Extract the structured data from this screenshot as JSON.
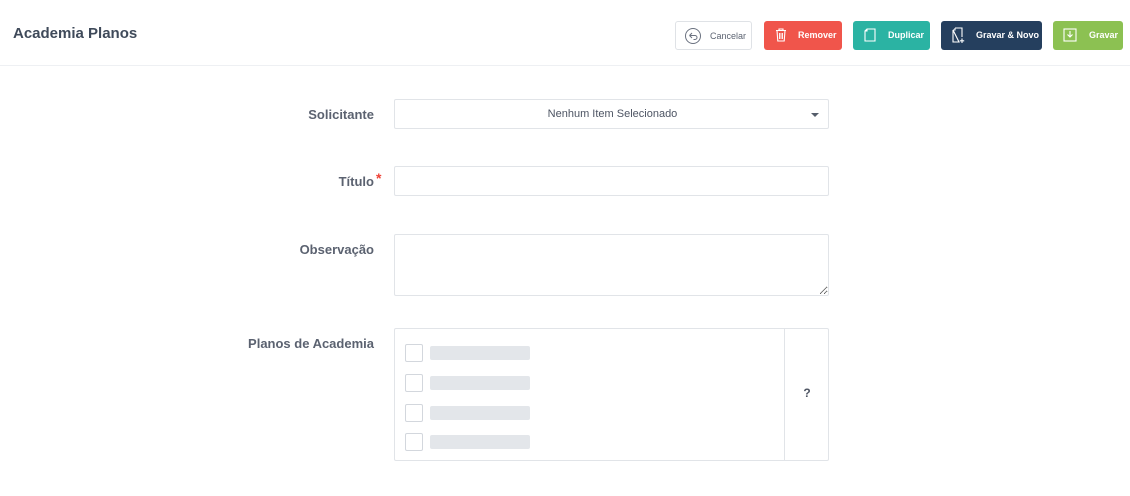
{
  "header": {
    "title": "Academia Planos"
  },
  "toolbar": {
    "cancel_label": "Cancelar",
    "remove_label": "Remover",
    "duplicate_label": "Duplicar",
    "save_new_label": "Gravar & Novo",
    "save_label": "Gravar"
  },
  "form": {
    "solicitante": {
      "label": "Solicitante",
      "selected": "Nenhum Item Selecionado"
    },
    "titulo": {
      "label": "Título",
      "required_mark": "*",
      "value": ""
    },
    "observacao": {
      "label": "Observação",
      "value": ""
    },
    "planos": {
      "label": "Planos de Academia",
      "help": "?",
      "items_loading": 4
    }
  },
  "colors": {
    "remove": "#f0554b",
    "duplicate": "#2bb3a3",
    "save_new": "#253f5e",
    "save": "#8cc152",
    "required": "#ef4136"
  },
  "icons": {
    "cancel": "undo-arrow-icon",
    "remove": "trash-icon",
    "duplicate": "copy-icon",
    "save_new": "file-plus-icon",
    "save": "save-download-icon"
  }
}
